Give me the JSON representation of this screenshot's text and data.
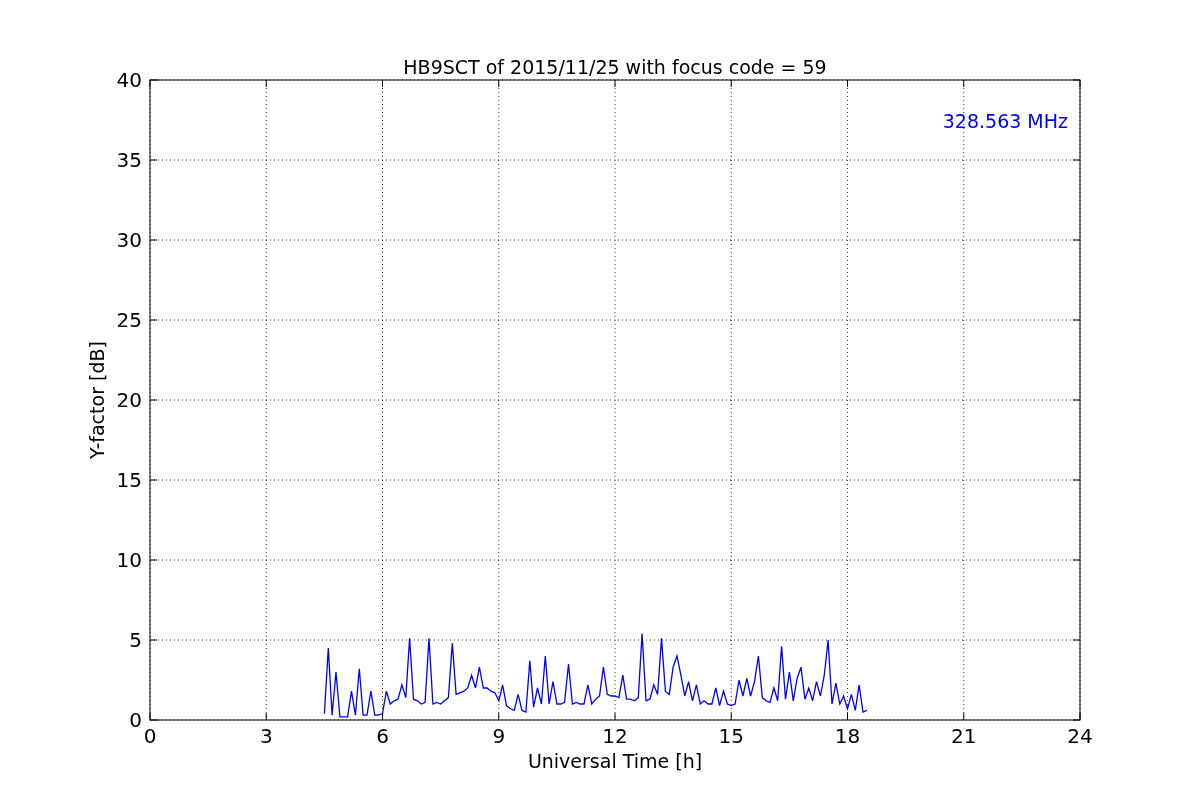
{
  "chart_data": {
    "type": "line",
    "title": "HB9SCT of 2015/11/25 with focus code = 59",
    "xlabel": "Universal Time [h]",
    "ylabel": "Y-factor [dB]",
    "x": [
      4.5,
      4.6,
      4.7,
      4.8,
      4.9,
      5.0,
      5.1,
      5.2,
      5.3,
      5.4,
      5.5,
      5.6,
      5.7,
      5.8,
      5.9,
      6.0,
      6.1,
      6.2,
      6.3,
      6.4,
      6.5,
      6.6,
      6.7,
      6.8,
      6.9,
      7.0,
      7.1,
      7.2,
      7.3,
      7.4,
      7.5,
      7.6,
      7.7,
      7.8,
      7.9,
      8.0,
      8.1,
      8.2,
      8.3,
      8.4,
      8.5,
      8.6,
      8.7,
      8.8,
      8.9,
      9.0,
      9.1,
      9.2,
      9.3,
      9.4,
      9.5,
      9.6,
      9.7,
      9.8,
      9.9,
      10.0,
      10.1,
      10.2,
      10.3,
      10.4,
      10.5,
      10.6,
      10.7,
      10.8,
      10.9,
      11.0,
      11.1,
      11.2,
      11.3,
      11.4,
      11.5,
      11.6,
      11.7,
      11.8,
      11.9,
      12.0,
      12.1,
      12.2,
      12.3,
      12.4,
      12.5,
      12.6,
      12.7,
      12.8,
      12.9,
      13.0,
      13.1,
      13.2,
      13.3,
      13.4,
      13.5,
      13.6,
      13.7,
      13.8,
      13.9,
      14.0,
      14.1,
      14.2,
      14.3,
      14.4,
      14.5,
      14.6,
      14.7,
      14.8,
      14.9,
      15.0,
      15.1,
      15.2,
      15.3,
      15.4,
      15.5,
      15.6,
      15.7,
      15.8,
      15.9,
      16.0,
      16.1,
      16.2,
      16.3,
      16.4,
      16.5,
      16.6,
      16.7,
      16.8,
      16.9,
      17.0,
      17.1,
      17.2,
      17.3,
      17.4,
      17.5,
      17.6,
      17.7,
      17.8,
      17.9,
      18.0,
      18.1,
      18.2,
      18.3,
      18.4,
      18.5
    ],
    "series": [
      {
        "name": "328.563 MHz",
        "color": "#0000ff",
        "values": [
          0.4,
          4.5,
          0.3,
          3.0,
          0.2,
          0.2,
          0.2,
          1.8,
          0.3,
          3.2,
          0.3,
          0.3,
          1.8,
          0.3,
          0.3,
          0.4,
          1.8,
          1.0,
          1.2,
          1.3,
          2.2,
          1.4,
          5.1,
          1.3,
          1.2,
          1.0,
          1.1,
          5.1,
          1.0,
          1.1,
          1.0,
          1.2,
          1.4,
          4.8,
          1.6,
          1.7,
          1.8,
          2.0,
          2.8,
          2.0,
          3.3,
          2.0,
          2.0,
          1.8,
          1.7,
          1.2,
          2.2,
          0.9,
          0.7,
          0.6,
          1.6,
          0.6,
          0.5,
          3.7,
          0.8,
          2.0,
          1.0,
          4.0,
          1.0,
          2.4,
          1.0,
          1.0,
          1.1,
          3.5,
          1.0,
          1.1,
          1.0,
          1.0,
          2.2,
          1.0,
          1.3,
          1.5,
          3.3,
          1.6,
          1.5,
          1.5,
          1.4,
          2.8,
          1.3,
          1.3,
          1.2,
          1.4,
          5.4,
          1.2,
          1.3,
          2.2,
          1.6,
          5.1,
          1.8,
          1.6,
          3.3,
          4.0,
          2.8,
          1.5,
          2.4,
          1.2,
          2.2,
          1.0,
          1.2,
          1.0,
          1.0,
          2.0,
          0.9,
          1.8,
          1.0,
          0.9,
          1.0,
          2.5,
          1.5,
          2.6,
          1.5,
          2.4,
          4.0,
          1.4,
          1.2,
          1.1,
          2.0,
          1.2,
          4.6,
          1.3,
          3.0,
          1.2,
          2.6,
          3.3,
          1.3,
          2.0,
          1.2,
          2.4,
          1.5,
          2.8,
          5.0,
          1.0,
          2.3,
          1.0,
          1.5,
          0.7,
          1.6,
          0.6,
          2.2,
          0.5,
          0.6
        ]
      }
    ],
    "xlim": [
      0,
      24
    ],
    "ylim": [
      0,
      40
    ],
    "xticks": [
      0,
      3,
      6,
      9,
      12,
      15,
      18,
      21,
      24
    ],
    "yticks": [
      0,
      5,
      10,
      15,
      20,
      25,
      30,
      35,
      40
    ],
    "grid": true
  }
}
